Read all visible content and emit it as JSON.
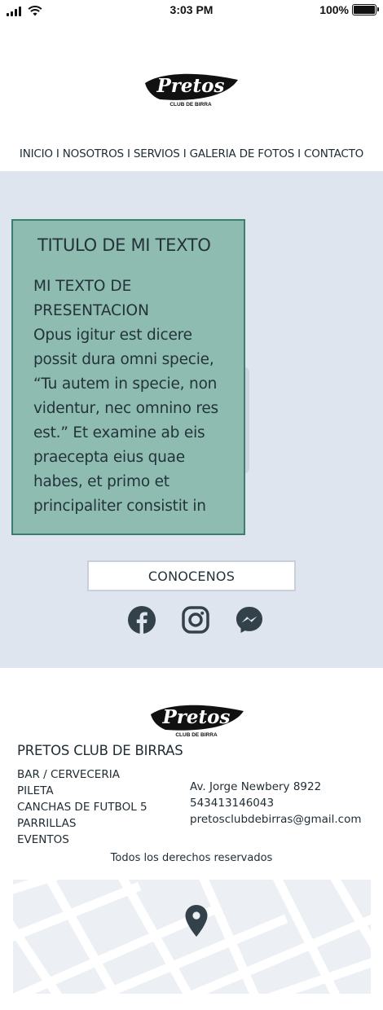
{
  "status_bar": {
    "time": "3:03 PM",
    "battery": "100%"
  },
  "brand": {
    "logo_text": "Pretos",
    "logo_tagline": "CLUB DE BIRRA"
  },
  "nav": {
    "text": "INICIO I NOSOTROS I SERVIOS I GALERIA DE FOTOS I CONTACTO"
  },
  "hero": {
    "card_title": "TITULO DE MI TEXTO",
    "card_subtitle": " MI TEXTO DE\nPRESENTACION",
    "card_body": "Opus igitur est dicere possit dura omni specie, “Tu autem in specie, non videntur, nec omnino res est.” Et examine ab eis praecepta eius quae habes, et primo et principaliter consistit in",
    "cta_label": "CONOCENOS",
    "socials": [
      "facebook-icon",
      "instagram-icon",
      "messenger-icon"
    ]
  },
  "footer": {
    "title": "PRETOS CLUB DE BIRRAS",
    "services": [
      "BAR / CERVECERIA",
      "PILETA",
      "CANCHAS DE FUTBOL 5",
      "PARRILLAS",
      "EVENTOS"
    ],
    "address": "Av. Jorge Newbery 8922",
    "phone": "543413146043",
    "email": "pretosclubdebirras@gmail.com",
    "rights": "Todos los derechos reservados",
    "map_icon": "map-pin-icon"
  },
  "colors": {
    "hero_bg": "#dfe5ee",
    "card_bg": "#8fbcb1",
    "card_border": "#3a7f6e",
    "icon": "#33414a"
  }
}
